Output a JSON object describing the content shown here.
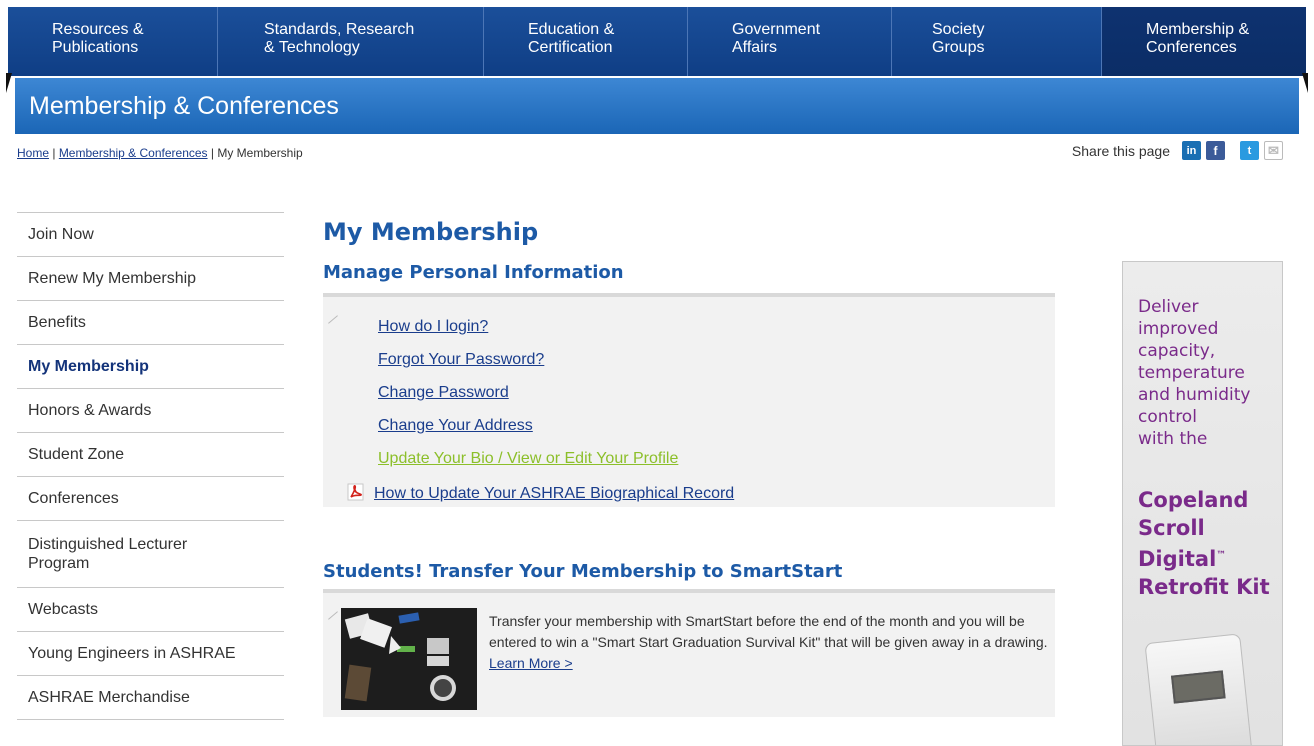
{
  "nav": {
    "items": [
      {
        "label": "Resources &\nPublications"
      },
      {
        "label": "Standards, Research\n& Technology"
      },
      {
        "label": "Education &\nCertification"
      },
      {
        "label": "Government\nAffairs"
      },
      {
        "label": "Society\nGroups"
      },
      {
        "label": "Membership &\nConferences"
      }
    ]
  },
  "banner": {
    "title": "Membership & Conferences"
  },
  "breadcrumb": {
    "home": "Home",
    "sep": " | ",
    "section": "Membership & Conferences",
    "current": "My Membership"
  },
  "share": {
    "label": "Share this page",
    "linkedin_glyph": "in",
    "facebook_glyph": "f",
    "twitter_glyph": "t",
    "email_glyph": "✉"
  },
  "sidebar": {
    "items": [
      {
        "label": "Join Now"
      },
      {
        "label": "Renew My Membership"
      },
      {
        "label": "Benefits"
      },
      {
        "label": "My Membership"
      },
      {
        "label": "Honors & Awards"
      },
      {
        "label": "Student Zone"
      },
      {
        "label": "Conferences"
      },
      {
        "label": "Distinguished Lecturer\nProgram"
      },
      {
        "label": "Webcasts"
      },
      {
        "label": "Young Engineers in ASHRAE"
      },
      {
        "label": "ASHRAE Merchandise"
      }
    ]
  },
  "main": {
    "title": "My Membership",
    "section1": {
      "heading": "Manage Personal Information",
      "links": [
        "How do I login?",
        "Forgot Your Password?",
        "Change Password",
        "Change Your Address",
        "Update Your Bio / View or Edit Your Profile"
      ],
      "pdf_link": "How to Update Your ASHRAE Biographical Record"
    },
    "section2": {
      "heading": "Students! Transfer Your Membership to SmartStart",
      "text": "Transfer your membership with SmartStart before the end of the month and you will be entered to win a \"Smart Start Graduation Survival Kit\" that will be given away in a drawing. ",
      "learn_more": "Learn More >"
    }
  },
  "ad": {
    "lines": [
      "Deliver",
      "improved",
      "capacity,",
      "temperature",
      "and humidity",
      "control",
      "with the"
    ],
    "product": [
      "Copeland",
      "Scroll",
      "Digital",
      "Retrofit Kit"
    ],
    "trademark": "™"
  },
  "colors": {
    "nav_blue": "#0f3e85",
    "banner_blue": "#2a74c2",
    "link_blue": "#1a3d8c",
    "heading_blue": "#1d5aa6",
    "visited_green": "#8cbf2a",
    "ad_purple": "#7a2a8a"
  }
}
